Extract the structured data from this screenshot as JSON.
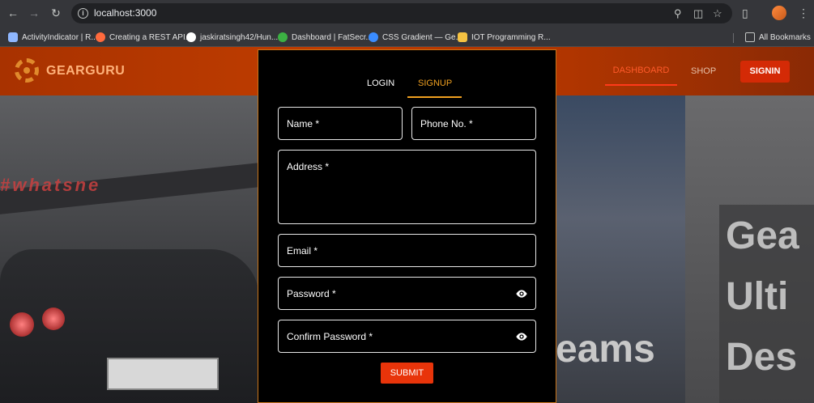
{
  "browser": {
    "url": "localhost:3000",
    "bookmarks": [
      {
        "label": "ActivityIndicator | R...",
        "color": "#8fb7ff"
      },
      {
        "label": "Creating a REST API...",
        "color": "#ff6a3d"
      },
      {
        "label": "jaskiratsingh42/Hun...",
        "color": "#ffffff"
      },
      {
        "label": "Dashboard | FatSecr...",
        "color": "#3cb043"
      },
      {
        "label": "CSS Gradient — Ge...",
        "color": "#3a8cff"
      },
      {
        "label": "IOT Programming R...",
        "color": "#f5c242"
      }
    ],
    "all_bookmarks": "All Bookmarks"
  },
  "navbar": {
    "brand": "GEARGURU",
    "dashboard": "DASHBOARD",
    "shop": "SHOP",
    "signin": "SIGNIN"
  },
  "hero": {
    "words": [
      "Gea",
      "Ulti",
      "Des"
    ],
    "reams": "eams",
    "wing_text": "#whatsne"
  },
  "modal": {
    "tabs": {
      "login": "LOGIN",
      "signup": "SIGNUP",
      "active": "signup"
    },
    "fields": {
      "name": "Name *",
      "phone": "Phone No. *",
      "address": "Address *",
      "email": "Email *",
      "password": "Password *",
      "confirm_password": "Confirm Password *"
    },
    "submit": "SUBMIT"
  },
  "colors": {
    "accent": "#f0a020",
    "brand": "#c03d00",
    "submit": "#e8340a"
  }
}
